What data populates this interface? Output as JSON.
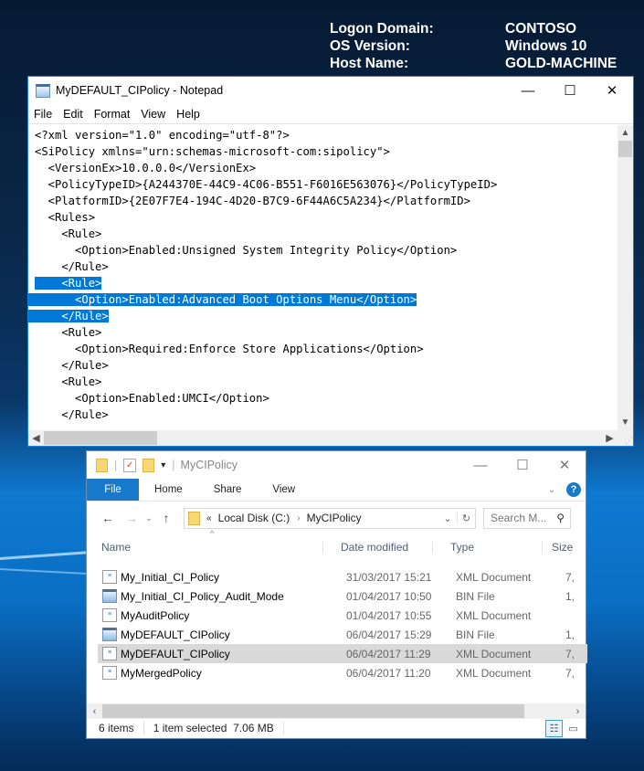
{
  "desktop": {
    "logon_info": [
      {
        "label": "Logon Domain:",
        "value": "CONTOSO"
      },
      {
        "label": "OS Version:",
        "value": "Windows 10"
      },
      {
        "label": "Host Name:",
        "value": "GOLD-MACHINE"
      }
    ]
  },
  "notepad": {
    "title": "MyDEFAULT_CIPolicy - Notepad",
    "window_buttons": {
      "minimize": "—",
      "maximize": "☐",
      "close": "✕"
    },
    "menu": [
      "File",
      "Edit",
      "Format",
      "View",
      "Help"
    ],
    "lines": [
      {
        "text": "<?xml version=\"1.0\" encoding=\"utf-8\"?>",
        "selected": false
      },
      {
        "text": "<SiPolicy xmlns=\"urn:schemas-microsoft-com:sipolicy\">",
        "selected": false
      },
      {
        "text": "  <VersionEx>10.0.0.0</VersionEx>",
        "selected": false
      },
      {
        "text": "  <PolicyTypeID>{A244370E-44C9-4C06-B551-F6016E563076}</PolicyTypeID>",
        "selected": false
      },
      {
        "text": "  <PlatformID>{2E07F7E4-194C-4D20-B7C9-6F44A6C5A234}</PlatformID>",
        "selected": false
      },
      {
        "text": "  <Rules>",
        "selected": false
      },
      {
        "text": "    <Rule>",
        "selected": false
      },
      {
        "text": "      <Option>Enabled:Unsigned System Integrity Policy</Option>",
        "selected": false
      },
      {
        "text": "    </Rule>",
        "selected": false
      },
      {
        "text": "    <Rule>",
        "selected": true
      },
      {
        "text": "      <Option>Enabled:Advanced Boot Options Menu</Option>",
        "selected": true
      },
      {
        "text": "    </Rule>",
        "selected": true
      },
      {
        "text": "    <Rule>",
        "selected": false
      },
      {
        "text": "      <Option>Required:Enforce Store Applications</Option>",
        "selected": false
      },
      {
        "text": "    </Rule>",
        "selected": false
      },
      {
        "text": "    <Rule>",
        "selected": false
      },
      {
        "text": "      <Option>Enabled:UMCI</Option>",
        "selected": false
      },
      {
        "text": "    </Rule>",
        "selected": false
      }
    ],
    "colors": {
      "selection": "#0078d7",
      "border": "#1883d7"
    }
  },
  "explorer": {
    "title": "MyCIPolicy",
    "window_buttons": {
      "minimize": "—",
      "maximize": "☐",
      "close": "✕"
    },
    "ribbon_tabs": [
      "File",
      "Home",
      "Share",
      "View"
    ],
    "help_label": "?",
    "address": {
      "overflow": "«",
      "crumbs": [
        "Local Disk (C:)",
        "MyCIPolicy"
      ]
    },
    "search_placeholder": "Search M...",
    "columns": [
      "Name",
      "Date modified",
      "Type",
      "Size"
    ],
    "files": [
      {
        "name": "My_Initial_CI_Policy",
        "date": "31/03/2017 15:21",
        "type": "XML Document",
        "size": "7,",
        "icon": "xml-file-icon",
        "selected": false
      },
      {
        "name": "My_Initial_CI_Policy_Audit_Mode",
        "date": "01/04/2017 10:50",
        "type": "BIN File",
        "size": "1,",
        "icon": "bin-file-icon",
        "selected": false
      },
      {
        "name": "MyAuditPolicy",
        "date": "01/04/2017 10:55",
        "type": "XML Document",
        "size": "",
        "icon": "xml-file-icon",
        "selected": false
      },
      {
        "name": "MyDEFAULT_CIPolicy",
        "date": "06/04/2017 15:29",
        "type": "BIN File",
        "size": "1,",
        "icon": "bin-file-icon",
        "selected": false
      },
      {
        "name": "MyDEFAULT_CIPolicy",
        "date": "06/04/2017 11:29",
        "type": "XML Document",
        "size": "7,",
        "icon": "xml-file-icon",
        "selected": true
      },
      {
        "name": "MyMergedPolicy",
        "date": "06/04/2017 11:20",
        "type": "XML Document",
        "size": "7,",
        "icon": "xml-file-icon",
        "selected": false
      }
    ],
    "status": {
      "item_count": "6 items",
      "selection": "1 item selected  7.06 MB"
    },
    "colors": {
      "accent": "#1979ca",
      "selected_row": "#d9d9d9"
    }
  }
}
